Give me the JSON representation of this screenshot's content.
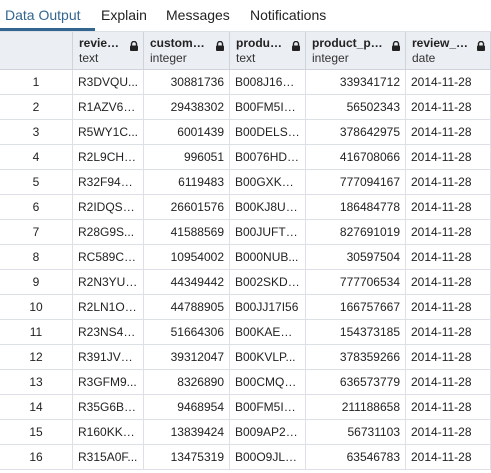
{
  "tabs": [
    {
      "label": "Data Output",
      "active": true
    },
    {
      "label": "Explain",
      "active": false
    },
    {
      "label": "Messages",
      "active": false
    },
    {
      "label": "Notifications",
      "active": false
    }
  ],
  "columns": [
    {
      "name": "review_id",
      "type": "text",
      "align": "left"
    },
    {
      "name": "customer_id",
      "type": "integer",
      "align": "right"
    },
    {
      "name": "product_id",
      "type": "text",
      "align": "left"
    },
    {
      "name": "product_parent",
      "type": "integer",
      "align": "right"
    },
    {
      "name": "review_date",
      "type": "date",
      "align": "left"
    }
  ],
  "rows": [
    {
      "n": "1",
      "cells": [
        "R3DVQU...",
        "30881736",
        "B008J16A...",
        "339341712",
        "2014-11-28"
      ]
    },
    {
      "n": "2",
      "cells": [
        "R1AZV6R...",
        "29438302",
        "B00FM5IY...",
        "56502343",
        "2014-11-28"
      ]
    },
    {
      "n": "3",
      "cells": [
        "R5WY1C...",
        "6001439",
        "B00DELSJ...",
        "378642975",
        "2014-11-28"
      ]
    },
    {
      "n": "4",
      "cells": [
        "R2L9CHO...",
        "996051",
        "B0076HD2...",
        "416708066",
        "2014-11-28"
      ]
    },
    {
      "n": "5",
      "cells": [
        "R32F94Q...",
        "6119483",
        "B00GXKU...",
        "777094167",
        "2014-11-28"
      ]
    },
    {
      "n": "6",
      "cells": [
        "R2IDQS2...",
        "26601576",
        "B00KJ8UP...",
        "186484778",
        "2014-11-28"
      ]
    },
    {
      "n": "7",
      "cells": [
        "R28G9S...",
        "41588569",
        "B00JUFT3...",
        "827691019",
        "2014-11-28"
      ]
    },
    {
      "n": "8",
      "cells": [
        "RC589CF...",
        "10954002",
        "B000NUB...",
        "30597504",
        "2014-11-28"
      ]
    },
    {
      "n": "9",
      "cells": [
        "R2N3YUI...",
        "44349442",
        "B002SKDI...",
        "777706534",
        "2014-11-28"
      ]
    },
    {
      "n": "10",
      "cells": [
        "R2LN1OZ...",
        "44788905",
        "B00JJ17I56",
        "166757667",
        "2014-11-28"
      ]
    },
    {
      "n": "11",
      "cells": [
        "R23NS4N...",
        "51664306",
        "B00KAED6...",
        "154373185",
        "2014-11-28"
      ]
    },
    {
      "n": "12",
      "cells": [
        "R391JVB...",
        "39312047",
        "B00KVLP...",
        "378359266",
        "2014-11-28"
      ]
    },
    {
      "n": "13",
      "cells": [
        "R3GFM9...",
        "8326890",
        "B00CMQT...",
        "636573779",
        "2014-11-28"
      ]
    },
    {
      "n": "14",
      "cells": [
        "R35G6BK...",
        "9468954",
        "B00FM5IY...",
        "211188658",
        "2014-11-28"
      ]
    },
    {
      "n": "15",
      "cells": [
        "R160KKF...",
        "13839424",
        "B009AP23...",
        "56731103",
        "2014-11-28"
      ]
    },
    {
      "n": "16",
      "cells": [
        "R315A0F...",
        "13475319",
        "B00O9JLA...",
        "63546783",
        "2014-11-28"
      ]
    }
  ],
  "colors": {
    "accent": "#326690",
    "header_bg": "#ebeef3",
    "grid_line": "#dde0e6"
  },
  "icons": {
    "column_header": "lock-icon"
  }
}
